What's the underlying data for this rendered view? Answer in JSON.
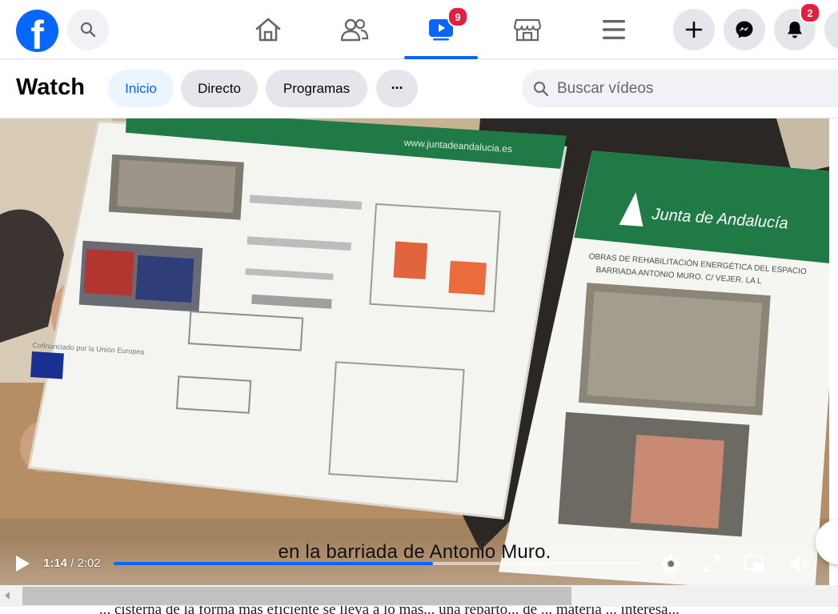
{
  "topbar": {
    "logo": "facebook-logo",
    "search_icon": "search-icon",
    "nav": [
      {
        "name": "home",
        "icon": "home-icon",
        "active": false
      },
      {
        "name": "friends",
        "icon": "friends-icon",
        "active": false
      },
      {
        "name": "watch",
        "icon": "watch-icon",
        "active": true,
        "badge": "9"
      },
      {
        "name": "marketplace",
        "icon": "marketplace-icon",
        "active": false
      },
      {
        "name": "menu",
        "icon": "menu-icon",
        "active": false
      }
    ],
    "actions": {
      "create_icon": "plus-icon",
      "messenger_icon": "messenger-icon",
      "notifications_icon": "bell-icon",
      "notifications_badge": "2"
    }
  },
  "watch": {
    "title": "Watch",
    "tabs": [
      "Inicio",
      "Directo",
      "Programas"
    ],
    "active_tab": "Inicio",
    "more_label": "···",
    "search_placeholder": "Buscar vídeos"
  },
  "video": {
    "subtitle": "en  la barriada de Antonio Muro.",
    "current_time": "1:14",
    "duration": "2:02",
    "progress_fraction": 0.603,
    "poster_left_url": "www.juntadeandalucia.es",
    "poster_right_brand": "Junta de Andalucía",
    "poster_right_line1": "OBRAS DE REHABILITACIÓN ENERGÉTICA DEL ESPACIO",
    "poster_right_line2": "BARRIADA ANTONIO MURO.  C/ VEJER. LA L",
    "poster_left_footer": "Cofinanciado por la Unión Europea"
  },
  "colors": {
    "accent": "#0866ff",
    "badge": "#e41e3f",
    "junta_green": "#1f7a45"
  },
  "below_text": "... cisterna de la forma más eficiente se lleva a lo mas... una reparto... de ... materia ... interesa..."
}
